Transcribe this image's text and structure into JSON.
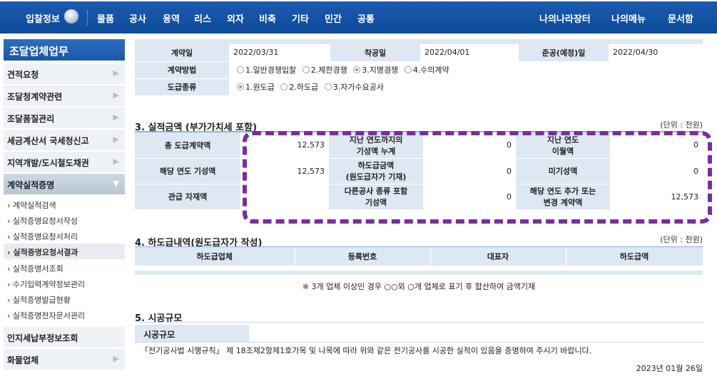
{
  "topnav": {
    "brand": "입찰정보",
    "items": [
      "물품",
      "공사",
      "용역",
      "리스",
      "외자",
      "비축",
      "기타",
      "민간",
      "공통"
    ],
    "right": [
      "나의나라장터",
      "나의메뉴",
      "문서함"
    ]
  },
  "sidebar": {
    "title": "조달업체업무",
    "items": [
      "견적요청",
      "조달청계약관련",
      "조달품질관리",
      "세금계산서 국세청신고",
      "지역개발/도시철도채권",
      "계약실적증명"
    ],
    "subitems": [
      "계약실적검색",
      "실적증명요청서작성",
      "실적증명요청서처리",
      "실적증명요청서결과",
      "실적증명서조회",
      "수기입력계약정보관리",
      "실적증명발급현황",
      "실적증명전자문서관리"
    ],
    "bottom_items": [
      "인지세납부정보조회",
      "화물업체"
    ]
  },
  "contract": {
    "contract_date_label": "계약일",
    "contract_date": "2022/03/31",
    "start_label": "착공일",
    "start_date": "2022/04/01",
    "end_label": "준공(예정)일",
    "end_date": "2022/04/30",
    "method_label": "계약방법",
    "methods": [
      "1.일반경쟁입찰",
      "2.제한경쟁",
      "3.지명경쟁",
      "4.수의계약"
    ],
    "type_label": "도급종류",
    "types": [
      "1.원도급",
      "2.하도급",
      "3.자가수요공사"
    ]
  },
  "section3": {
    "title": "3. 실적금액 (부가가치세 포함)",
    "unit": "(단위 : 천원)",
    "r1": {
      "l1": "총 도급계약액",
      "v1": "12,573",
      "l2a": "지난 연도까지의",
      "l2b": "기성액 누계",
      "v2": "0",
      "l3a": "지난 연도",
      "l3b": "이월액",
      "v3": "0"
    },
    "r2": {
      "l1": "해당 연도 기성액",
      "v1": "12,573",
      "l2a": "하도급금액",
      "l2b": "(원도급자가 기재)",
      "v2": "0",
      "l3": "미기성액",
      "v3": "0"
    },
    "r3": {
      "l1": "관급 자재액",
      "v1": "",
      "l2a": "다른공사 종류 포함",
      "l2b": "기성액",
      "v2": "0",
      "l3a": "해당 연도 추가 또는",
      "l3b": "변경 계약액",
      "v3": "12,573"
    }
  },
  "section4": {
    "title": "4. 하도급내역(원도급자가 작성)",
    "unit": "(단위 : 천원)",
    "headers": [
      "하도급업체",
      "등록번호",
      "대표자",
      "하도급액"
    ],
    "note": "※ 3개 업체 이상인 경우 ○○외 ○개 업체로 표기 후 합산하여 금액기재"
  },
  "section5": {
    "title": "5. 시공규모",
    "box_label": "시공규모",
    "text": "「전기공사법 시행규칙」 제 18조제2항제1호가목 및 나목에 따라 위와 같은 전기공사를 시공한 실적이 있음을 증명하여 주시기 바랍니다.",
    "date": "2023년 01월 26일"
  }
}
